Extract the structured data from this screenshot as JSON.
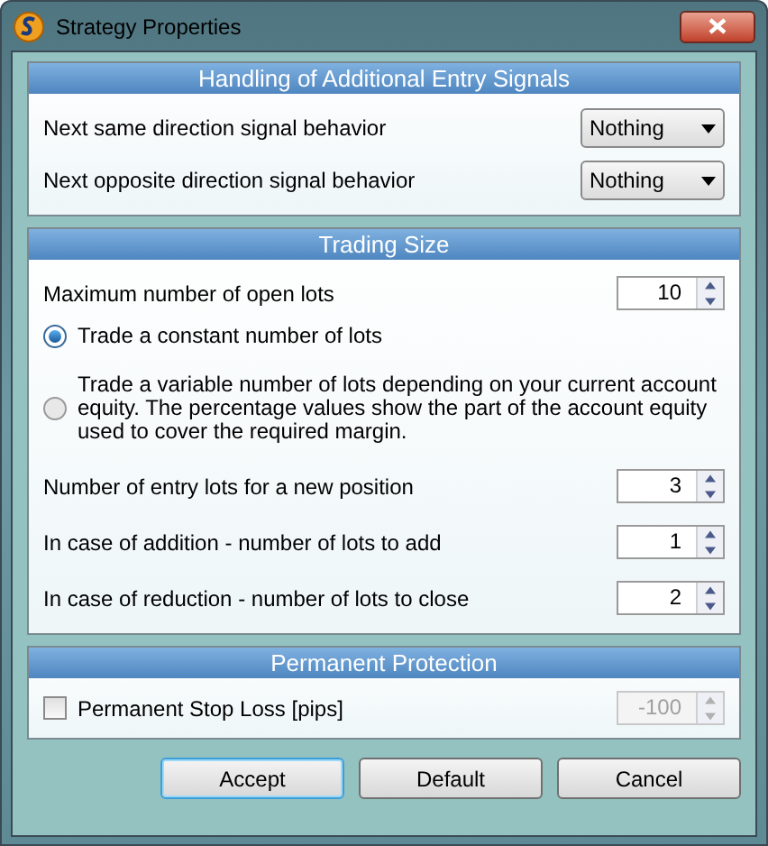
{
  "window": {
    "title": "Strategy Properties"
  },
  "entry_signals": {
    "title": "Handling of Additional Entry Signals",
    "rows": [
      {
        "label": "Next same direction signal behavior",
        "value": "Nothing"
      },
      {
        "label": "Next opposite direction signal behavior",
        "value": "Nothing"
      }
    ]
  },
  "trading_size": {
    "title": "Trading Size",
    "max_lots": {
      "label": "Maximum number of open lots",
      "value": "10"
    },
    "options": [
      {
        "label": "Trade a constant number of lots",
        "selected": true
      },
      {
        "label": "Trade a variable number of lots depending on your current account equity. The percentage values show the part of the account equity used to cover the required margin.",
        "selected": false
      }
    ],
    "fields": [
      {
        "label": "Number of entry lots for a new position",
        "value": "3"
      },
      {
        "label": "In case of addition - number of lots to add",
        "value": "1"
      },
      {
        "label": "In case of reduction - number of lots to close",
        "value": "2"
      }
    ]
  },
  "protection": {
    "title": "Permanent Protection",
    "stop_loss": {
      "label": "Permanent Stop Loss [pips]",
      "checked": false,
      "value": "-100",
      "disabled": true
    }
  },
  "buttons": [
    {
      "label": "Accept",
      "focused": true
    },
    {
      "label": "Default",
      "focused": false
    },
    {
      "label": "Cancel",
      "focused": false
    }
  ]
}
